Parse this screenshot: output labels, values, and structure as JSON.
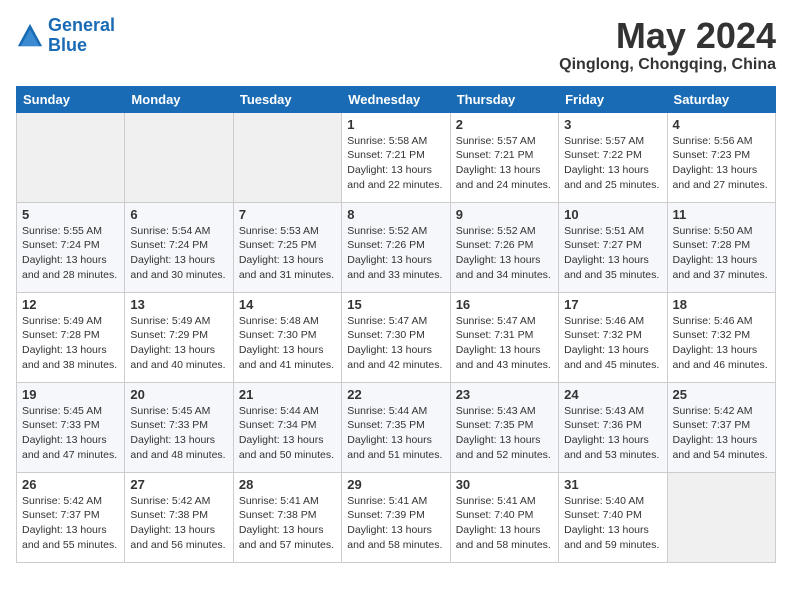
{
  "logo": {
    "text_general": "General",
    "text_blue": "Blue"
  },
  "header": {
    "month": "May 2024",
    "location": "Qinglong, Chongqing, China"
  },
  "weekdays": [
    "Sunday",
    "Monday",
    "Tuesday",
    "Wednesday",
    "Thursday",
    "Friday",
    "Saturday"
  ],
  "weeks": [
    [
      {
        "day": "",
        "sunrise": "",
        "sunset": "",
        "daylight": ""
      },
      {
        "day": "",
        "sunrise": "",
        "sunset": "",
        "daylight": ""
      },
      {
        "day": "",
        "sunrise": "",
        "sunset": "",
        "daylight": ""
      },
      {
        "day": "1",
        "sunrise": "Sunrise: 5:58 AM",
        "sunset": "Sunset: 7:21 PM",
        "daylight": "Daylight: 13 hours and 22 minutes."
      },
      {
        "day": "2",
        "sunrise": "Sunrise: 5:57 AM",
        "sunset": "Sunset: 7:21 PM",
        "daylight": "Daylight: 13 hours and 24 minutes."
      },
      {
        "day": "3",
        "sunrise": "Sunrise: 5:57 AM",
        "sunset": "Sunset: 7:22 PM",
        "daylight": "Daylight: 13 hours and 25 minutes."
      },
      {
        "day": "4",
        "sunrise": "Sunrise: 5:56 AM",
        "sunset": "Sunset: 7:23 PM",
        "daylight": "Daylight: 13 hours and 27 minutes."
      }
    ],
    [
      {
        "day": "5",
        "sunrise": "Sunrise: 5:55 AM",
        "sunset": "Sunset: 7:24 PM",
        "daylight": "Daylight: 13 hours and 28 minutes."
      },
      {
        "day": "6",
        "sunrise": "Sunrise: 5:54 AM",
        "sunset": "Sunset: 7:24 PM",
        "daylight": "Daylight: 13 hours and 30 minutes."
      },
      {
        "day": "7",
        "sunrise": "Sunrise: 5:53 AM",
        "sunset": "Sunset: 7:25 PM",
        "daylight": "Daylight: 13 hours and 31 minutes."
      },
      {
        "day": "8",
        "sunrise": "Sunrise: 5:52 AM",
        "sunset": "Sunset: 7:26 PM",
        "daylight": "Daylight: 13 hours and 33 minutes."
      },
      {
        "day": "9",
        "sunrise": "Sunrise: 5:52 AM",
        "sunset": "Sunset: 7:26 PM",
        "daylight": "Daylight: 13 hours and 34 minutes."
      },
      {
        "day": "10",
        "sunrise": "Sunrise: 5:51 AM",
        "sunset": "Sunset: 7:27 PM",
        "daylight": "Daylight: 13 hours and 35 minutes."
      },
      {
        "day": "11",
        "sunrise": "Sunrise: 5:50 AM",
        "sunset": "Sunset: 7:28 PM",
        "daylight": "Daylight: 13 hours and 37 minutes."
      }
    ],
    [
      {
        "day": "12",
        "sunrise": "Sunrise: 5:49 AM",
        "sunset": "Sunset: 7:28 PM",
        "daylight": "Daylight: 13 hours and 38 minutes."
      },
      {
        "day": "13",
        "sunrise": "Sunrise: 5:49 AM",
        "sunset": "Sunset: 7:29 PM",
        "daylight": "Daylight: 13 hours and 40 minutes."
      },
      {
        "day": "14",
        "sunrise": "Sunrise: 5:48 AM",
        "sunset": "Sunset: 7:30 PM",
        "daylight": "Daylight: 13 hours and 41 minutes."
      },
      {
        "day": "15",
        "sunrise": "Sunrise: 5:47 AM",
        "sunset": "Sunset: 7:30 PM",
        "daylight": "Daylight: 13 hours and 42 minutes."
      },
      {
        "day": "16",
        "sunrise": "Sunrise: 5:47 AM",
        "sunset": "Sunset: 7:31 PM",
        "daylight": "Daylight: 13 hours and 43 minutes."
      },
      {
        "day": "17",
        "sunrise": "Sunrise: 5:46 AM",
        "sunset": "Sunset: 7:32 PM",
        "daylight": "Daylight: 13 hours and 45 minutes."
      },
      {
        "day": "18",
        "sunrise": "Sunrise: 5:46 AM",
        "sunset": "Sunset: 7:32 PM",
        "daylight": "Daylight: 13 hours and 46 minutes."
      }
    ],
    [
      {
        "day": "19",
        "sunrise": "Sunrise: 5:45 AM",
        "sunset": "Sunset: 7:33 PM",
        "daylight": "Daylight: 13 hours and 47 minutes."
      },
      {
        "day": "20",
        "sunrise": "Sunrise: 5:45 AM",
        "sunset": "Sunset: 7:33 PM",
        "daylight": "Daylight: 13 hours and 48 minutes."
      },
      {
        "day": "21",
        "sunrise": "Sunrise: 5:44 AM",
        "sunset": "Sunset: 7:34 PM",
        "daylight": "Daylight: 13 hours and 50 minutes."
      },
      {
        "day": "22",
        "sunrise": "Sunrise: 5:44 AM",
        "sunset": "Sunset: 7:35 PM",
        "daylight": "Daylight: 13 hours and 51 minutes."
      },
      {
        "day": "23",
        "sunrise": "Sunrise: 5:43 AM",
        "sunset": "Sunset: 7:35 PM",
        "daylight": "Daylight: 13 hours and 52 minutes."
      },
      {
        "day": "24",
        "sunrise": "Sunrise: 5:43 AM",
        "sunset": "Sunset: 7:36 PM",
        "daylight": "Daylight: 13 hours and 53 minutes."
      },
      {
        "day": "25",
        "sunrise": "Sunrise: 5:42 AM",
        "sunset": "Sunset: 7:37 PM",
        "daylight": "Daylight: 13 hours and 54 minutes."
      }
    ],
    [
      {
        "day": "26",
        "sunrise": "Sunrise: 5:42 AM",
        "sunset": "Sunset: 7:37 PM",
        "daylight": "Daylight: 13 hours and 55 minutes."
      },
      {
        "day": "27",
        "sunrise": "Sunrise: 5:42 AM",
        "sunset": "Sunset: 7:38 PM",
        "daylight": "Daylight: 13 hours and 56 minutes."
      },
      {
        "day": "28",
        "sunrise": "Sunrise: 5:41 AM",
        "sunset": "Sunset: 7:38 PM",
        "daylight": "Daylight: 13 hours and 57 minutes."
      },
      {
        "day": "29",
        "sunrise": "Sunrise: 5:41 AM",
        "sunset": "Sunset: 7:39 PM",
        "daylight": "Daylight: 13 hours and 58 minutes."
      },
      {
        "day": "30",
        "sunrise": "Sunrise: 5:41 AM",
        "sunset": "Sunset: 7:40 PM",
        "daylight": "Daylight: 13 hours and 58 minutes."
      },
      {
        "day": "31",
        "sunrise": "Sunrise: 5:40 AM",
        "sunset": "Sunset: 7:40 PM",
        "daylight": "Daylight: 13 hours and 59 minutes."
      },
      {
        "day": "",
        "sunrise": "",
        "sunset": "",
        "daylight": ""
      }
    ]
  ]
}
